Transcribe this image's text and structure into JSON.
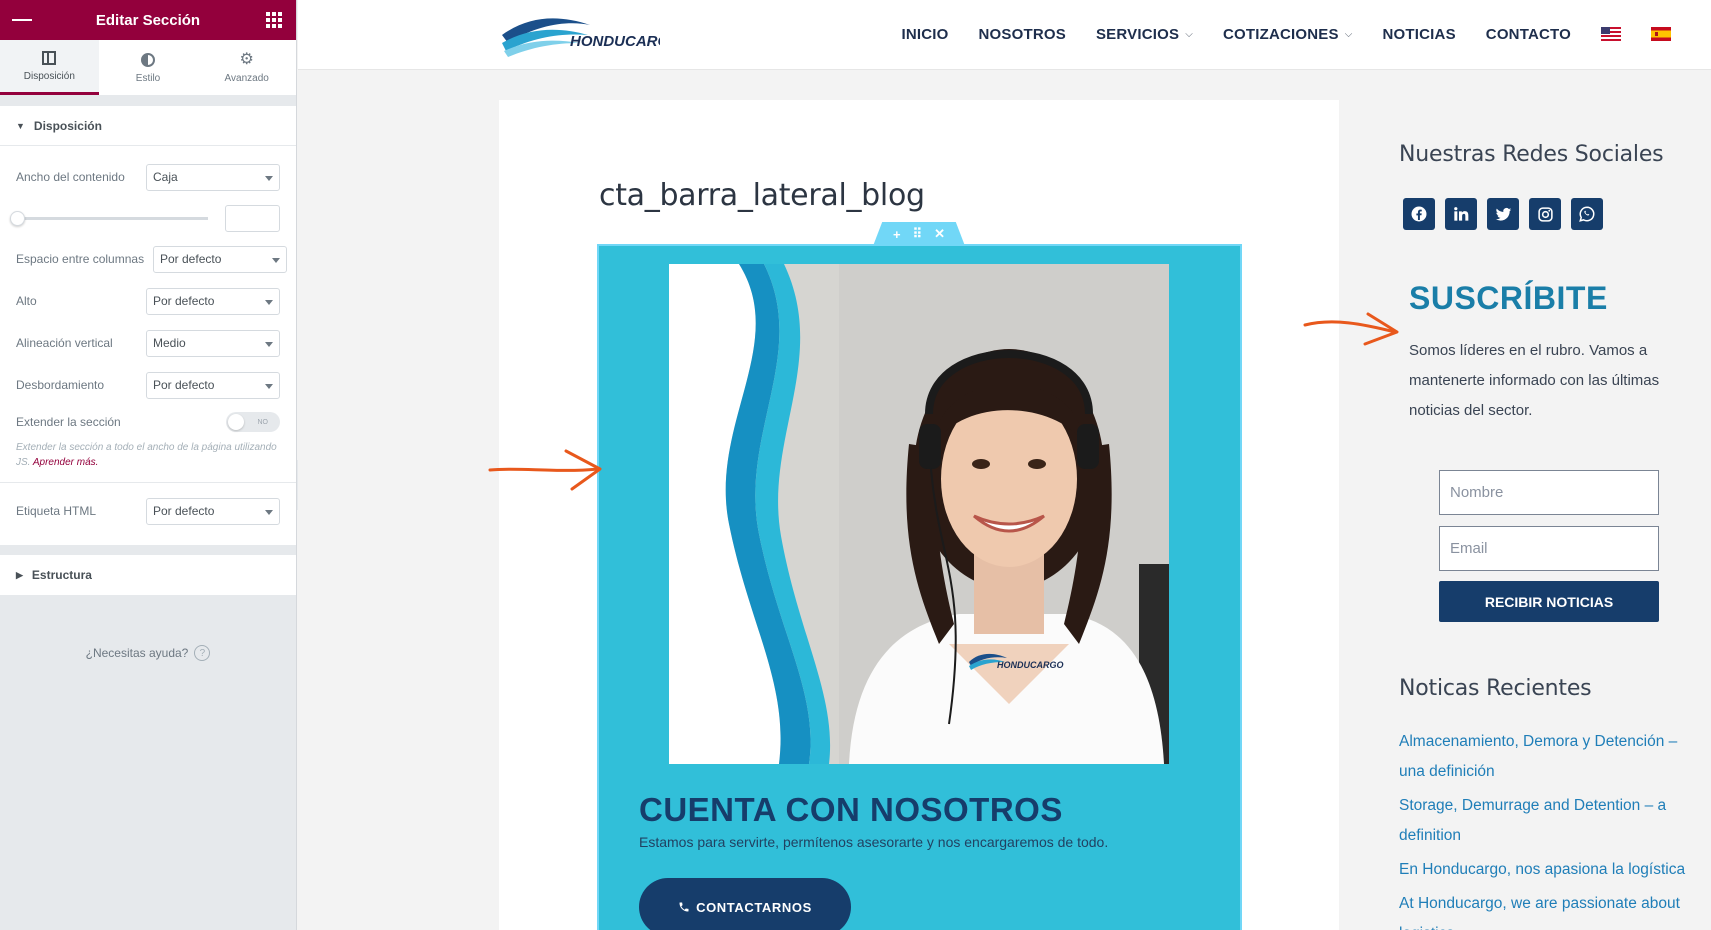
{
  "panel": {
    "title": "Editar Sección",
    "tabs": [
      {
        "label": "Disposición"
      },
      {
        "label": "Estilo"
      },
      {
        "label": "Avanzado"
      }
    ],
    "section_title": "Disposición",
    "controls": {
      "content_width": {
        "label": "Ancho del contenido",
        "value": "Caja"
      },
      "column_gap": {
        "label": "Espacio entre columnas",
        "value": "Por defecto"
      },
      "height": {
        "label": "Alto",
        "value": "Por defecto"
      },
      "vertical_align": {
        "label": "Alineación vertical",
        "value": "Medio"
      },
      "overflow": {
        "label": "Desbordamiento",
        "value": "Por defecto"
      },
      "stretch": {
        "label": "Extender la sección",
        "toggle": "NO"
      },
      "stretch_desc": "Extender la sección a todo el ancho de la página utilizando JS.",
      "stretch_link": "Aprender más.",
      "html_tag": {
        "label": "Etiqueta HTML",
        "value": "Por defecto"
      }
    },
    "structure_title": "Estructura",
    "help": "¿Necesitas ayuda?",
    "help_icon": "?",
    "collapse_icon": "‹"
  },
  "nav": {
    "logo_text": "HONDUCARGO",
    "items": [
      {
        "label": "INICIO",
        "dropdown": false
      },
      {
        "label": "NOSOTROS",
        "dropdown": false
      },
      {
        "label": "SERVICIOS",
        "dropdown": true
      },
      {
        "label": "COTIZACIONES",
        "dropdown": true
      },
      {
        "label": "NOTICIAS",
        "dropdown": false
      },
      {
        "label": "CONTACTO",
        "dropdown": false
      }
    ],
    "chevron": "⌵",
    "flags": [
      "us-flag-icon",
      "es-flag-icon"
    ]
  },
  "main": {
    "post_title": "cta_barra_lateral_blog",
    "handle": {
      "add": "+",
      "move": "⠿",
      "close": "✕"
    },
    "cta": {
      "heading": "CUENTA CON NOSOTROS",
      "text": "Estamos para servirte, permítenos asesorarte y nos encargaremos de todo.",
      "button": "CONTACTARNOS",
      "button_icon": "phone-icon"
    }
  },
  "sidebar": {
    "social_title": "Nuestras Redes Sociales",
    "socials": [
      "facebook-icon",
      "linkedin-icon",
      "twitter-icon",
      "instagram-icon",
      "whatsapp-icon"
    ],
    "subscribe_title": "SUSCRÍBITE",
    "subscribe_text": "Somos líderes en el rubro. Vamos a mantenerte informado con las últimas noticias del sector.",
    "name_placeholder": "Nombre",
    "email_placeholder": "Email",
    "subscribe_button": "RECIBIR NOTICIAS",
    "recent_title": "Noticas Recientes",
    "recent": [
      "Almacenamiento, Demora y Detención – una definición",
      "Storage, Demurrage and Detention – a definition",
      "En Honducargo, nos apasiona la logística",
      "At Honducargo, we are passionate about logistics"
    ]
  },
  "colors": {
    "editor_accent": "#93003c",
    "brand_navy": "#163d6b",
    "cta_cyan": "#31bfd9",
    "link_blue": "#1f7eb8",
    "annotation_orange": "#e8581c"
  }
}
